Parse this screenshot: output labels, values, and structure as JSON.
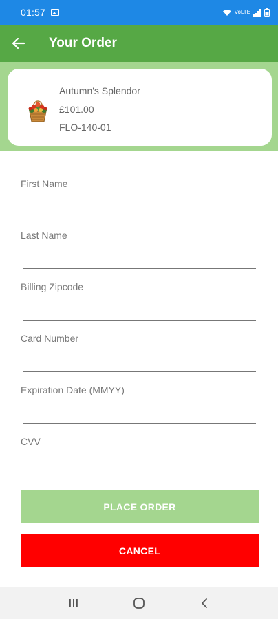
{
  "status_bar": {
    "time": "01:57",
    "network_label": "VoLTE"
  },
  "app_bar": {
    "title": "Your Order",
    "back_icon": "arrow-left-icon"
  },
  "product": {
    "name": "Autumn's Splendor",
    "price": "£101.00",
    "code": "FLO-140-01",
    "thumbnail_icon": "flower-basket-icon"
  },
  "form": {
    "fields": [
      {
        "label": "First Name",
        "value": ""
      },
      {
        "label": "Last Name",
        "value": ""
      },
      {
        "label": "Billing Zipcode",
        "value": ""
      },
      {
        "label": "Card Number",
        "value": ""
      },
      {
        "label": "Expiration Date (MMYY)",
        "value": ""
      },
      {
        "label": "CVV",
        "value": ""
      }
    ],
    "place_order_label": "PLACE ORDER",
    "cancel_label": "CANCEL"
  },
  "colors": {
    "status_bar": "#1e88e5",
    "app_bar": "#56a845",
    "band": "#a4d68f",
    "place_order": "#a4d68f",
    "cancel": "#ff0000"
  },
  "nav_bar": {
    "recents_icon": "recents-icon",
    "home_icon": "home-icon",
    "back_icon": "back-chevron-icon"
  }
}
